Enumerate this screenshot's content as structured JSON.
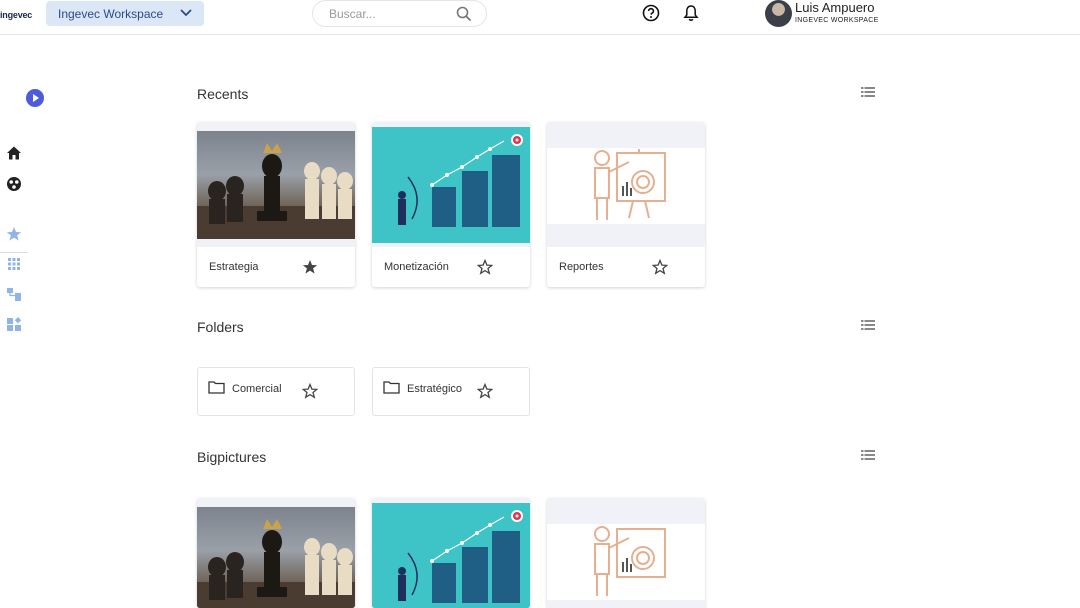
{
  "header": {
    "logo_text": "ingevec",
    "workspace_label": "Ingevec Workspace",
    "search_placeholder": "Buscar...",
    "user_name": "Luis Ampuero",
    "user_workspace": "INGEVEC WORKSPACE"
  },
  "sidebar": {
    "items": [
      {
        "icon": "home-icon"
      },
      {
        "icon": "explore-icon"
      },
      {
        "icon": "star-icon"
      },
      {
        "icon": "grid-icon"
      },
      {
        "icon": "hierarchy-icon"
      },
      {
        "icon": "widgets-icon"
      }
    ]
  },
  "sections": {
    "recents_title": "Recents",
    "folders_title": "Folders",
    "bigpictures_title": "Bigpictures"
  },
  "recents": [
    {
      "label": "Estrategia",
      "starred": true,
      "image": "chess"
    },
    {
      "label": "Monetización",
      "starred": false,
      "image": "growth-chart"
    },
    {
      "label": "Reportes",
      "starred": false,
      "image": "presentation"
    }
  ],
  "folders": [
    {
      "label": "Comercial",
      "starred": false
    },
    {
      "label": "Estratégico",
      "starred": false
    }
  ],
  "bigpictures": [
    {
      "image": "chess"
    },
    {
      "image": "growth-chart"
    },
    {
      "image": "presentation"
    }
  ],
  "colors": {
    "accent": "#4f5bdb",
    "workspace_bg": "#dbe6f7",
    "teal": "#3ec4c7",
    "sidebar_icon_blue": "#8fb4ea"
  }
}
